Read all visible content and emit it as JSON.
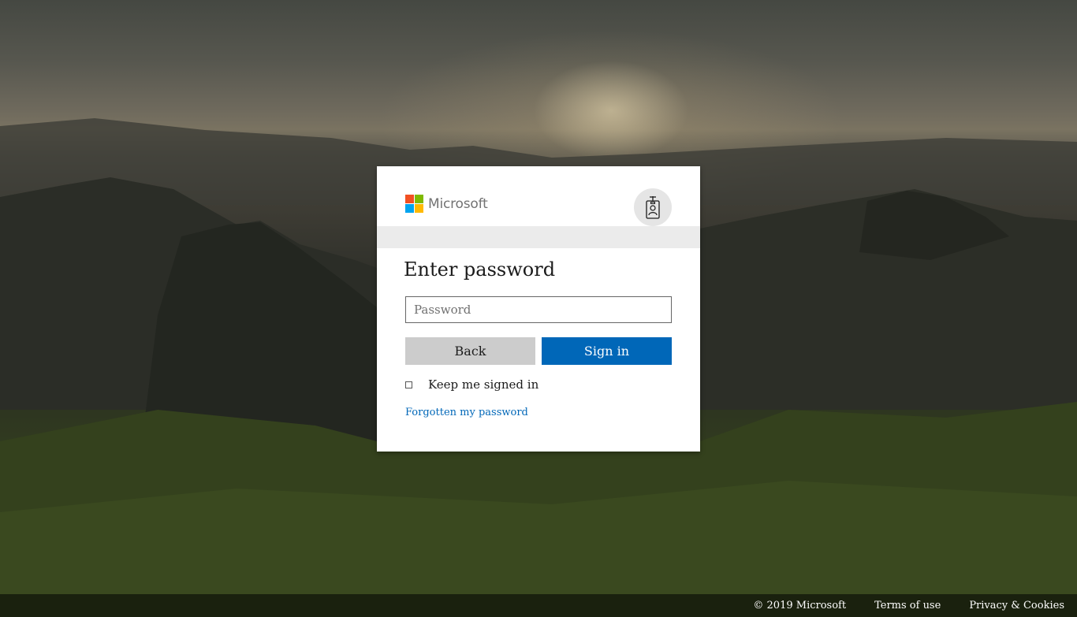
{
  "brand": {
    "name": "Microsoft",
    "colors": [
      "#f25022",
      "#7fba00",
      "#00a4ef",
      "#ffb900"
    ]
  },
  "header": {
    "badge_icon": "id-badge-icon"
  },
  "form": {
    "title": "Enter password",
    "password_placeholder": "Password",
    "password_value": "",
    "back_label": "Back",
    "signin_label": "Sign in",
    "keep_signed_in_label": "Keep me signed in",
    "keep_signed_in_checked": false,
    "forgot_link": "Forgotten my password"
  },
  "footer": {
    "copyright": "© 2019 Microsoft",
    "terms": "Terms of use",
    "privacy": "Privacy & Cookies"
  },
  "colors": {
    "accent": "#0067b8",
    "secondary_button": "#cccccc"
  }
}
